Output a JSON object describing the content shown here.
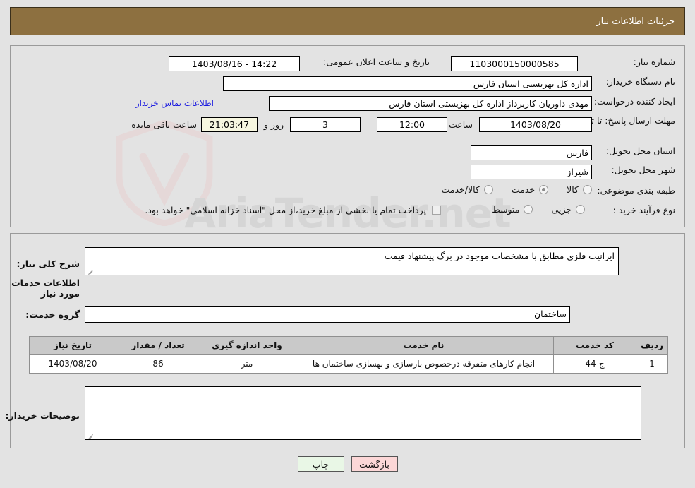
{
  "header": {
    "title": "جزئیات اطلاعات نیاز"
  },
  "watermark": {
    "text": "AriaTender.net"
  },
  "top": {
    "need_number_label": "شماره نیاز:",
    "need_number_value": "1103000150000585",
    "announce_label": "تاریخ و ساعت اعلان عمومی:",
    "announce_value": "14:22 - 1403/08/16",
    "buyer_org_label": "نام دستگاه خریدار:",
    "buyer_org_value": "اداره کل بهزیستی استان فارس",
    "creator_label": "ایجاد کننده درخواست:",
    "creator_value": "مهدی داوریان کاربرداز اداره کل بهزیستی استان فارس",
    "contact_link": "اطلاعات تماس خریدار",
    "deadline_label": "مهلت ارسال پاسخ: تا تاریخ:",
    "deadline_date": "1403/08/20",
    "hour_label": "ساعت",
    "deadline_time": "12:00",
    "days_value": "3",
    "days_label": "روز و",
    "countdown_value": "21:03:47",
    "remaining_label": "ساعت باقی مانده",
    "province_label": "استان محل تحویل:",
    "province_value": "فارس",
    "city_label": "شهر محل تحویل:",
    "city_value": "شیراز",
    "category_label": "طبقه بندی موضوعی:",
    "category_options": [
      {
        "label": "کالا",
        "selected": false
      },
      {
        "label": "خدمت",
        "selected": true
      },
      {
        "label": "کالا/خدمت",
        "selected": false
      }
    ],
    "process_label": "نوع فرآیند خرید :",
    "process_options": [
      {
        "label": "جزیی",
        "selected": false
      },
      {
        "label": "متوسط",
        "selected": false
      }
    ],
    "treasury_checkbox_label": "پرداخت تمام یا بخشی از مبلغ خرید،از محل \"اسناد خزانه اسلامی\" خواهد بود.",
    "treasury_checked": false
  },
  "main": {
    "general_desc_label": "شرح کلی نیاز:",
    "general_desc_value": "ایرانیت فلزی مطابق با مشخصات موجود در برگ پیشنهاد قیمت",
    "services_section_title": "اطلاعات خدمات مورد نیاز",
    "service_group_label": "گروه خدمت:",
    "service_group_value": "ساختمان",
    "table": {
      "columns": [
        "ردیف",
        "کد خدمت",
        "نام خدمت",
        "واحد اندازه گیری",
        "تعداد / مقدار",
        "تاریخ نیاز"
      ],
      "rows": [
        {
          "row_no": "1",
          "service_code": "ج-44",
          "service_name": "انجام کارهای متفرقه درخصوص بازسازی و بهسازی ساختمان ها",
          "unit": "متر",
          "quantity": "86",
          "need_date": "1403/08/20"
        }
      ]
    },
    "buyer_notes_label": "توضیحات خریدار:",
    "buyer_notes_value": ""
  },
  "buttons": {
    "back": "بازگشت",
    "print": "چاپ"
  },
  "colors": {
    "header_brown": "#8d7040",
    "link_blue": "#1a1ae0",
    "back_button": "#fcd7d7",
    "print_button": "#e9f7e6",
    "timer_bg": "#f7f7e0",
    "table_header": "#c9c9c9",
    "page_bg": "#e3e3e3"
  }
}
